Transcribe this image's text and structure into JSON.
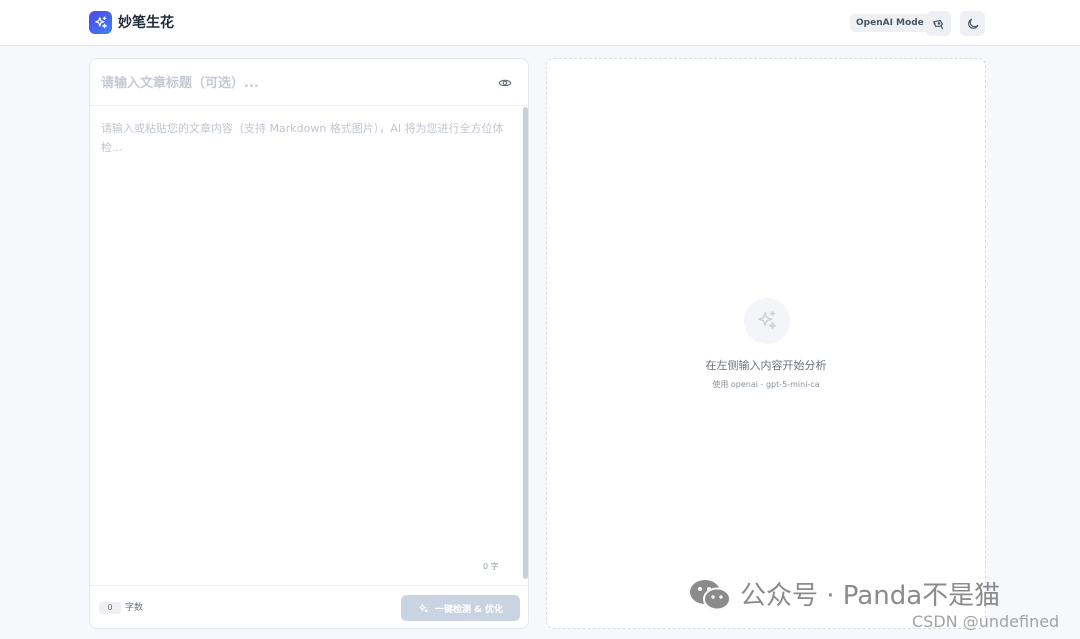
{
  "header": {
    "app_name": "妙笔生花",
    "mode_badge": "OpenAI Mode"
  },
  "editor": {
    "title_placeholder": "请输入文章标题（可选）...",
    "title_value": "",
    "content_placeholder": "请输入或粘贴您的文章内容（支持 Markdown 格式图片），AI 将为您进行全方位体检...",
    "content_value": "",
    "char_count_inline": "0 字",
    "word_count": "0",
    "word_count_label": "字数",
    "analyze_button": "一键检测 & 优化"
  },
  "result": {
    "empty_title": "在左侧输入内容开始分析",
    "empty_subtitle": "使用 openai - gpt-5-mini-ca"
  },
  "watermark": {
    "wechat": "公众号 · Panda不是猫",
    "csdn": "CSDN @undefined"
  },
  "icons": {
    "logo": "sparkles-icon",
    "robot": "robot-icon",
    "theme": "moon-icon",
    "preview": "eye-icon",
    "analyze": "sparkles-icon",
    "empty": "sparkles-icon"
  },
  "colors": {
    "brand": "#4f46e5",
    "button_disabled": "#c9d3e2",
    "background": "#f6f8fb"
  }
}
